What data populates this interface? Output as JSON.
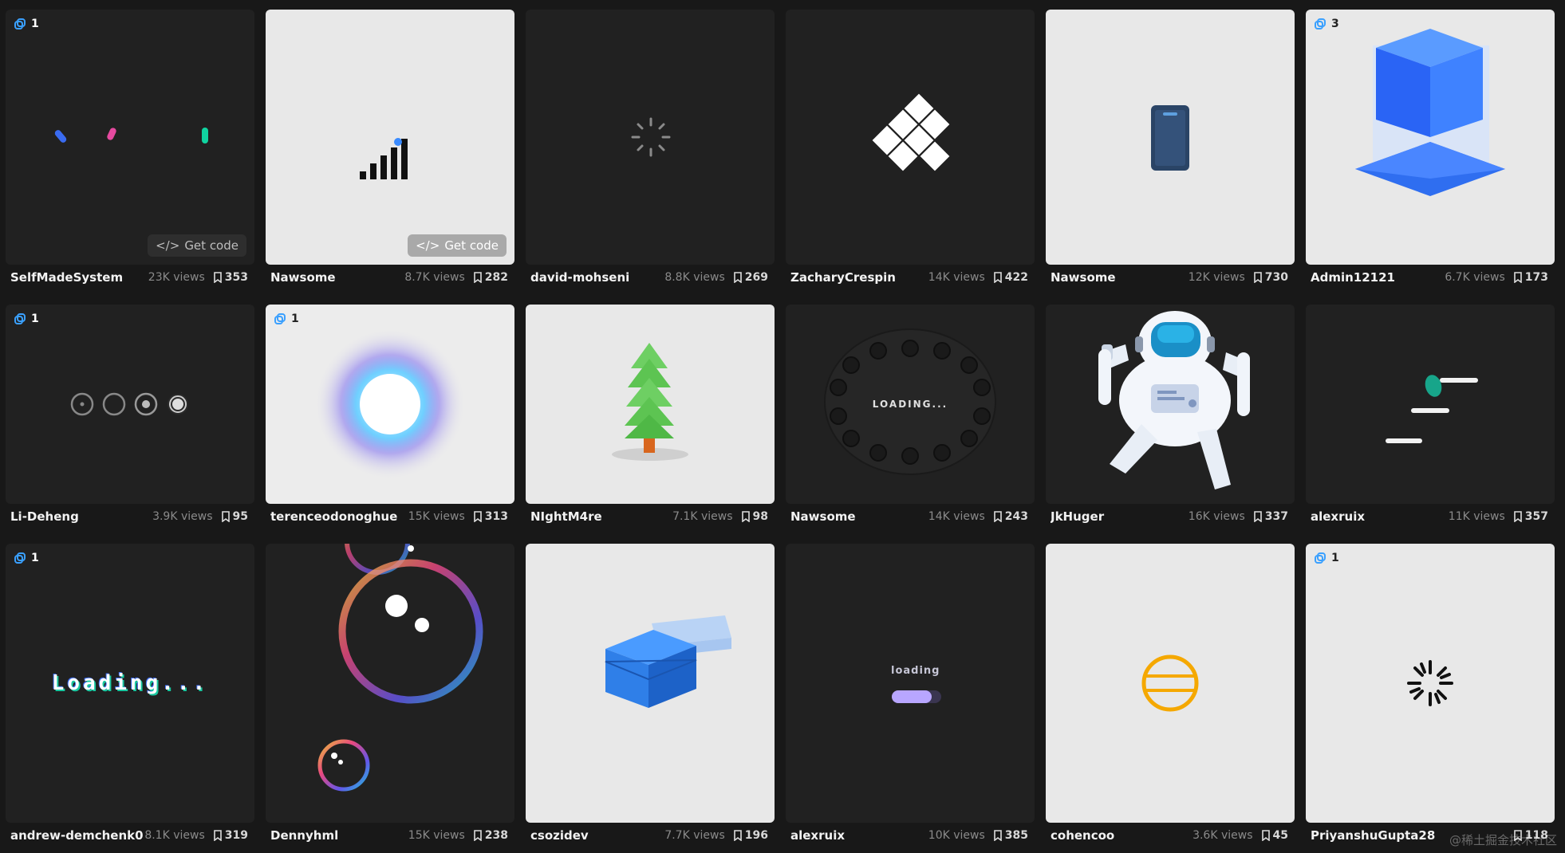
{
  "getcode_label": "Get code",
  "cards": [
    {
      "author": "SelfMadeSystem",
      "views": "23K views",
      "saves": "353",
      "badge": "1"
    },
    {
      "author": "Nawsome",
      "views": "8.7K views",
      "saves": "282"
    },
    {
      "author": "david-mohseni",
      "views": "8.8K views",
      "saves": "269"
    },
    {
      "author": "ZacharyCrespin",
      "views": "14K views",
      "saves": "422"
    },
    {
      "author": "Nawsome",
      "views": "12K views",
      "saves": "730"
    },
    {
      "author": "Admin12121",
      "views": "6.7K views",
      "saves": "173",
      "badge": "3"
    },
    {
      "author": "Li-Deheng",
      "views": "3.9K views",
      "saves": "95",
      "badge": "1"
    },
    {
      "author": "terenceodonoghue",
      "views": "15K views",
      "saves": "313",
      "badge": "1"
    },
    {
      "author": "NIghtM4re",
      "views": "7.1K views",
      "saves": "98"
    },
    {
      "author": "Nawsome",
      "views": "14K views",
      "saves": "243",
      "loader_text": "LOADING..."
    },
    {
      "author": "JkHuger",
      "views": "16K views",
      "saves": "337"
    },
    {
      "author": "alexruix",
      "views": "11K views",
      "saves": "357"
    },
    {
      "author": "andrew-demchenk0",
      "views": "8.1K views",
      "saves": "319",
      "badge": "1",
      "loader_text": "Loading..."
    },
    {
      "author": "Dennyhml",
      "views": "15K views",
      "saves": "238"
    },
    {
      "author": "csozidev",
      "views": "7.7K views",
      "saves": "196"
    },
    {
      "author": "alexruix",
      "views": "10K views",
      "saves": "385",
      "loader_text": "loading"
    },
    {
      "author": "cohencoo",
      "views": "3.6K views",
      "saves": "45"
    },
    {
      "author": "PriyanshuGupta28",
      "views": "",
      "saves": "118",
      "badge": "1"
    }
  ],
  "watermark": "@稀土掘金技术社区"
}
